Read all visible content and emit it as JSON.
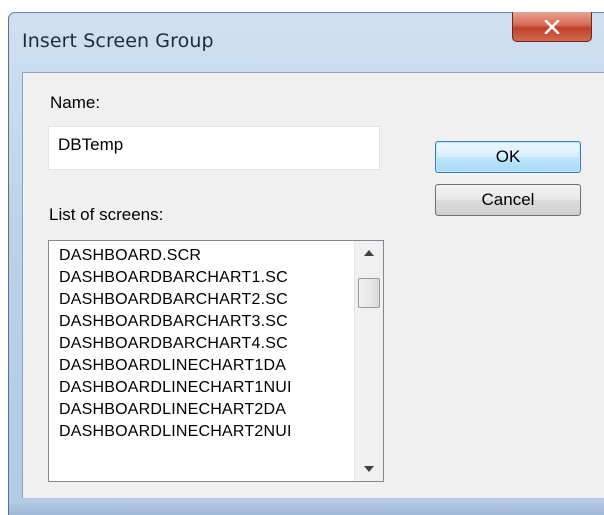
{
  "window": {
    "title": "Insert Screen Group"
  },
  "form": {
    "name_label": "Name:",
    "name_value": "DBTemp",
    "list_label": "List of screens:"
  },
  "buttons": {
    "ok": "OK",
    "cancel": "Cancel"
  },
  "screens": [
    "DASHBOARD.SCR",
    "DASHBOARDBARCHART1.SC",
    "DASHBOARDBARCHART2.SC",
    "DASHBOARDBARCHART3.SC",
    "DASHBOARDBARCHART4.SC",
    "DASHBOARDLINECHART1DA",
    "DASHBOARDLINECHART1NUI",
    "DASHBOARDLINECHART2DA",
    "DASHBOARDLINECHART2NUI"
  ],
  "scroll": {
    "position_fraction": 0.08
  },
  "colors": {
    "close_button": "#c7503b",
    "default_button_border": "#3c7fb1"
  }
}
